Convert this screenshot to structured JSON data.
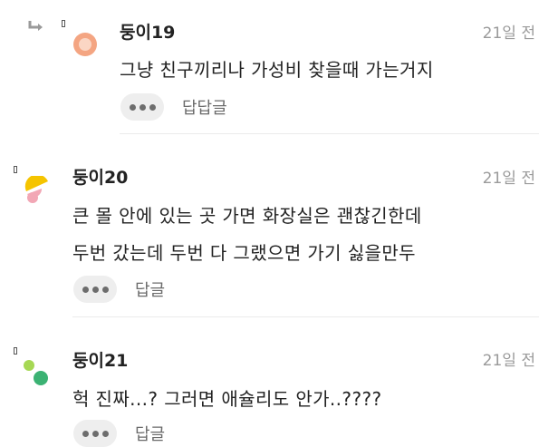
{
  "comments": [
    {
      "author": "둥이19",
      "time": "21일 전",
      "lines": [
        "그냥 친구끼리나 가성비 찾을때 가는거지"
      ],
      "reply_label": "답답글",
      "avatar_icon": "peach-circle-avatar-icon",
      "is_reply": true
    },
    {
      "author": "둥이20",
      "time": "21일 전",
      "lines": [
        "큰 몰 안에 있는 곳 가면 화장실은 괜찮긴한데",
        "두번 갔는데 두번 다 그랬으면 가기 싫을만두"
      ],
      "reply_label": "답글",
      "avatar_icon": "yellow-pink-shapes-avatar-icon",
      "is_reply": false
    },
    {
      "author": "둥이21",
      "time": "21일 전",
      "lines": [
        "헉 진짜...? 그러면 애슐리도 안가..????"
      ],
      "reply_label": "답글",
      "avatar_icon": "green-dots-avatar-icon",
      "is_reply": false
    }
  ],
  "colors": {
    "peach": "#f4a582",
    "yellow": "#f5c400",
    "pink": "#f2a7b5",
    "light_green": "#a6d854",
    "green": "#3bb273"
  }
}
